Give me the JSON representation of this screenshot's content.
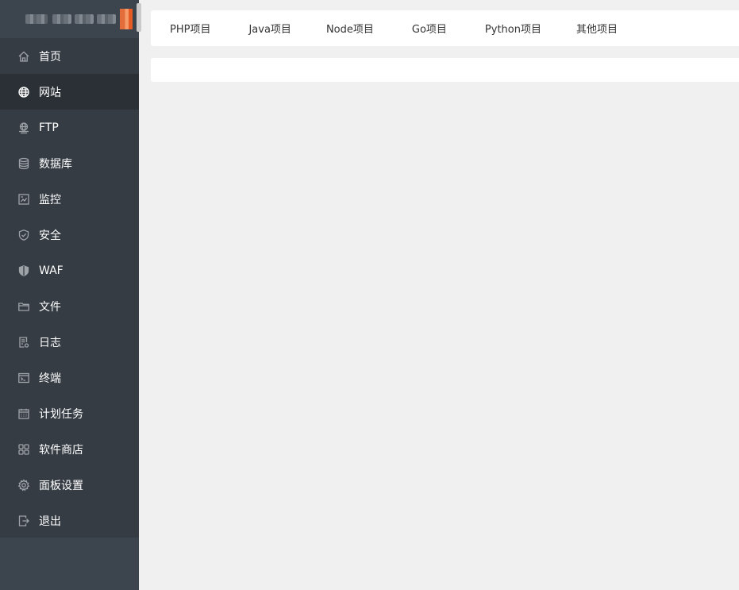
{
  "sidebar": {
    "items": [
      {
        "label": "首页",
        "icon": "home-icon",
        "active": false
      },
      {
        "label": "网站",
        "icon": "globe-icon",
        "active": true
      },
      {
        "label": "FTP",
        "icon": "ftp-icon",
        "active": false
      },
      {
        "label": "数据库",
        "icon": "database-icon",
        "active": false
      },
      {
        "label": "监控",
        "icon": "monitor-icon",
        "active": false
      },
      {
        "label": "安全",
        "icon": "shield-icon",
        "active": false
      },
      {
        "label": "WAF",
        "icon": "waf-shield-icon",
        "active": false
      },
      {
        "label": "文件",
        "icon": "folder-icon",
        "active": false
      },
      {
        "label": "日志",
        "icon": "log-icon",
        "active": false
      },
      {
        "label": "终端",
        "icon": "terminal-icon",
        "active": false
      },
      {
        "label": "计划任务",
        "icon": "calendar-icon",
        "active": false
      },
      {
        "label": "软件商店",
        "icon": "apps-grid-icon",
        "active": false
      },
      {
        "label": "面板设置",
        "icon": "gear-icon",
        "active": false
      },
      {
        "label": "退出",
        "icon": "logout-icon",
        "active": false
      }
    ]
  },
  "tabs": [
    {
      "label": "PHP项目"
    },
    {
      "label": "Java项目"
    },
    {
      "label": "Node项目"
    },
    {
      "label": "Go项目"
    },
    {
      "label": "Python项目"
    },
    {
      "label": "其他项目"
    }
  ],
  "colors": {
    "sidebar_bg": "#353c44",
    "sidebar_active_bg": "#2b3036",
    "page_bg": "#f0f0f0",
    "panel_bg": "#ffffff"
  }
}
